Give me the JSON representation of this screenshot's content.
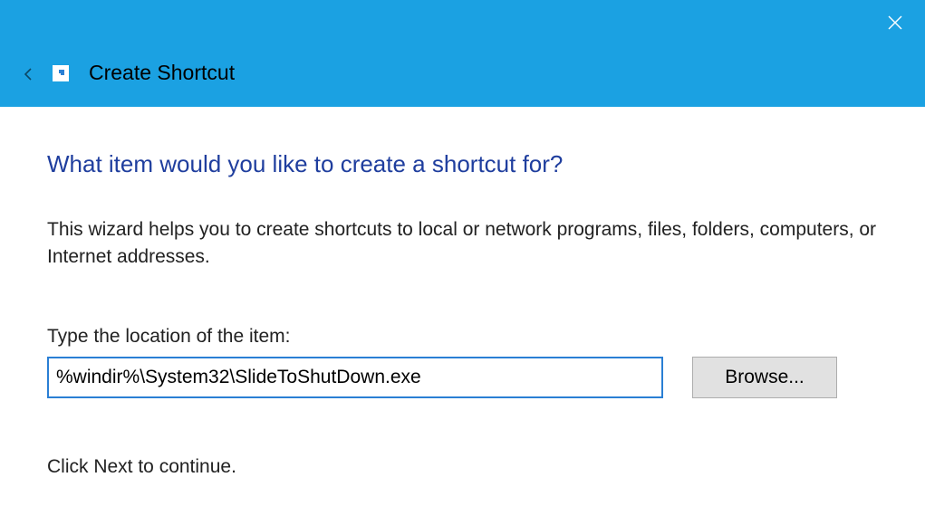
{
  "titlebar": {
    "title": "Create Shortcut"
  },
  "heading": "What item would you like to create a shortcut for?",
  "description": "This wizard helps you to create shortcuts to local or network programs, files, folders, computers, or Internet addresses.",
  "field_label": "Type the location of the item:",
  "location_value": "%windir%\\System32\\SlideToShutDown.exe",
  "browse_label": "Browse...",
  "continue_text": "Click Next to continue.",
  "colors": {
    "titlebar_bg": "#1ba1e2",
    "heading_color": "#1f3e9e",
    "input_border": "#2a7fd4"
  }
}
